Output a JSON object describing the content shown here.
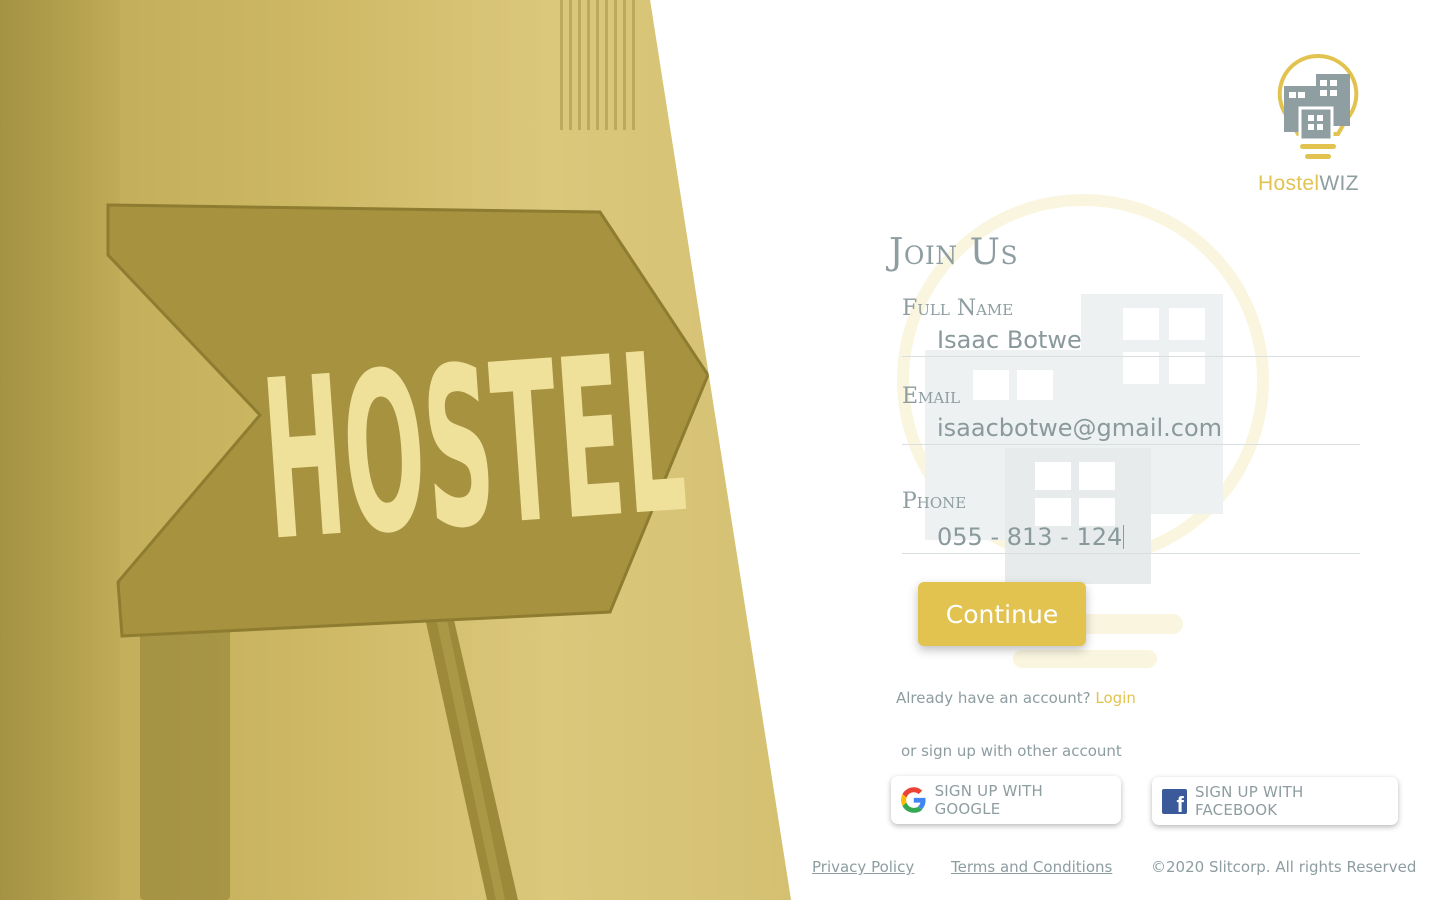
{
  "hero": {
    "sign_text": "HOSTEL"
  },
  "brand": {
    "name_part1": "Hostel",
    "name_part2": "WIZ",
    "accent": "#e2c34f",
    "secondary": "#8f9fa1"
  },
  "form": {
    "title": "Join Us",
    "fields": [
      {
        "label": "Full Name",
        "value": "Isaac Botwe"
      },
      {
        "label": "Email",
        "value": "isaacbotwe@gmail.com"
      },
      {
        "label": "Phone",
        "value": "055 - 813 - 124"
      }
    ],
    "continue_label": "Continue",
    "already_text": "Already have an account?",
    "login_label": "Login",
    "or_text": "or sign up with other account",
    "google_label": "SIGN UP WITH GOOGLE",
    "facebook_label": "SIGN UP WITH FACEBOOK"
  },
  "footer": {
    "privacy": "Privacy Policy",
    "terms": "Terms and Conditions",
    "copyright": "©2020 Slitcorp. All rights Reserved"
  },
  "icons": {
    "logo": "hostelwiz-bulb-logo-icon",
    "google": "google-icon",
    "facebook": "facebook-icon"
  }
}
